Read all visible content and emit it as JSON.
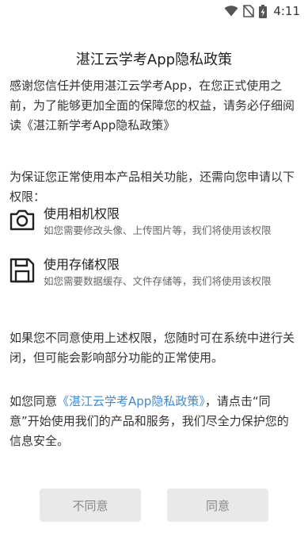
{
  "status_bar": {
    "time": "4:11",
    "icons": [
      "wifi-icon",
      "no-sim-icon",
      "battery-charging-icon"
    ]
  },
  "dialog": {
    "title": "湛江云学考App隐私政策",
    "intro": "感谢您信任并使用湛江云学考App，在您正式使用之前，为了能够更加全面的保障您的权益，请务必仔细阅读《湛江新学考App隐私政策》",
    "permissions_intro": "为保证您正常使用本产品相关功能，还需向您申请以下权限：",
    "permissions": [
      {
        "icon": "camera-icon",
        "title": "使用相机权限",
        "description": "如您需要修改头像、上传图片等，我们将使用该权限"
      },
      {
        "icon": "floppy-disk-icon",
        "title": "使用存储权限",
        "description": "如您需要数据缓存、文件存储等，我们将使用该权限"
      }
    ],
    "refusal_note": "如果您不同意使用上述权限，您随时可在系统中进行关闭，但可能会影响部分功能的正常使用。",
    "consent": {
      "prefix": "如您同意",
      "policy_link": "《湛江云学考App隐私政策》",
      "suffix": "，请点击“同意”开始使用我们的产品和服务，我们尽全力保护您的信息安全。"
    },
    "link_color": "#3d8bd8",
    "buttons": {
      "disagree": "不同意",
      "agree": "同意"
    }
  }
}
